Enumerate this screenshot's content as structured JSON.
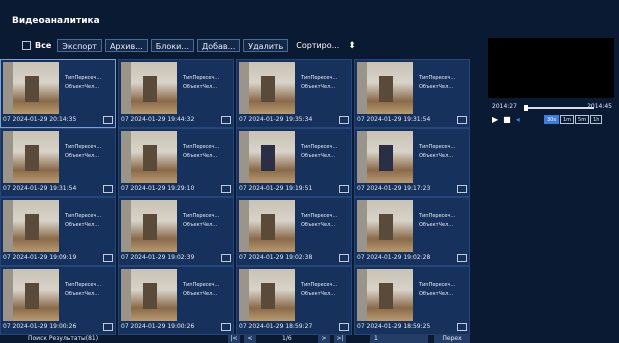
{
  "app": {
    "title": "Видеоаналитика"
  },
  "toolbar": {
    "all_label": "Все",
    "buttons": [
      "Экспорт",
      "Архив...",
      "Блоки...",
      "Добав...",
      "Удалить"
    ],
    "sort_label": "Сортиро..."
  },
  "cards": [
    {
      "time": "07 2024-01-29 20:14:35",
      "line1": "ТипПересеч...",
      "line2": "ОбъектЧел...",
      "selected": true
    },
    {
      "time": "07 2024-01-29 19:44:32",
      "line1": "ТипПересеч...",
      "line2": "ОбъектЧел..."
    },
    {
      "time": "07 2024-01-29 19:35:34",
      "line1": "ТипПересеч...",
      "line2": "ОбъектЧел..."
    },
    {
      "time": "07 2024-01-29 19:31:54",
      "line1": "ТипПересеч...",
      "line2": "ОбъектЧел..."
    },
    {
      "time": "07 2024-01-29 19:31:54",
      "line1": "ТипПересеч...",
      "line2": "ОбъектЧел..."
    },
    {
      "time": "07 2024-01-29 19:29:10",
      "line1": "ТипПересеч...",
      "line2": "ОбъектЧел..."
    },
    {
      "time": "07 2024-01-29 19:19:51",
      "line1": "ТипПересеч...",
      "line2": "ОбъектЧел...",
      "person": true
    },
    {
      "time": "07 2024-01-29 19:17:23",
      "line1": "ТипПересеч...",
      "line2": "ОбъектЧел..."
    },
    {
      "time": "07 2024-01-29 19:09:19",
      "line1": "ТипПересеч...",
      "line2": "ОбъектЧел..."
    },
    {
      "time": "07 2024-01-29 19:02:39",
      "line1": "ТипПересеч...",
      "line2": "ОбъектЧел..."
    },
    {
      "time": "07 2024-01-29 19:02:38",
      "line1": "ТипПересеч...",
      "line2": "ОбъектЧел..."
    },
    {
      "time": "07 2024-01-29 19:02:28",
      "line1": "ТипПересеч...",
      "line2": "ОбъектЧел..."
    },
    {
      "time": "07 2024-01-29 19:00:26",
      "line1": "ТипПересеч...",
      "line2": "ОбъектЧел..."
    },
    {
      "time": "07 2024-01-29 19:00:26",
      "line1": "ТипПересеч...",
      "line2": "ОбъектЧел..."
    },
    {
      "time": "07 2024-01-29 18:59:27",
      "line1": "ТипПересеч...",
      "line2": "ОбъектЧел..."
    },
    {
      "time": "07 2024-01-29 18:59:25",
      "line1": "ТипПересеч...",
      "line2": "ОбъектЧел..."
    }
  ],
  "player": {
    "time_start": "2014:27",
    "time_end": "2014:45",
    "rates": [
      "30s",
      "1m",
      "5m",
      "1h"
    ],
    "active_rate": "30s"
  },
  "footer": {
    "results": "Поиск Результаты(81)",
    "page": "1/6",
    "page_input": "1",
    "goto_label": "Перех",
    "first": "|<",
    "prev": "<",
    "next": ">",
    "last": ">|"
  }
}
